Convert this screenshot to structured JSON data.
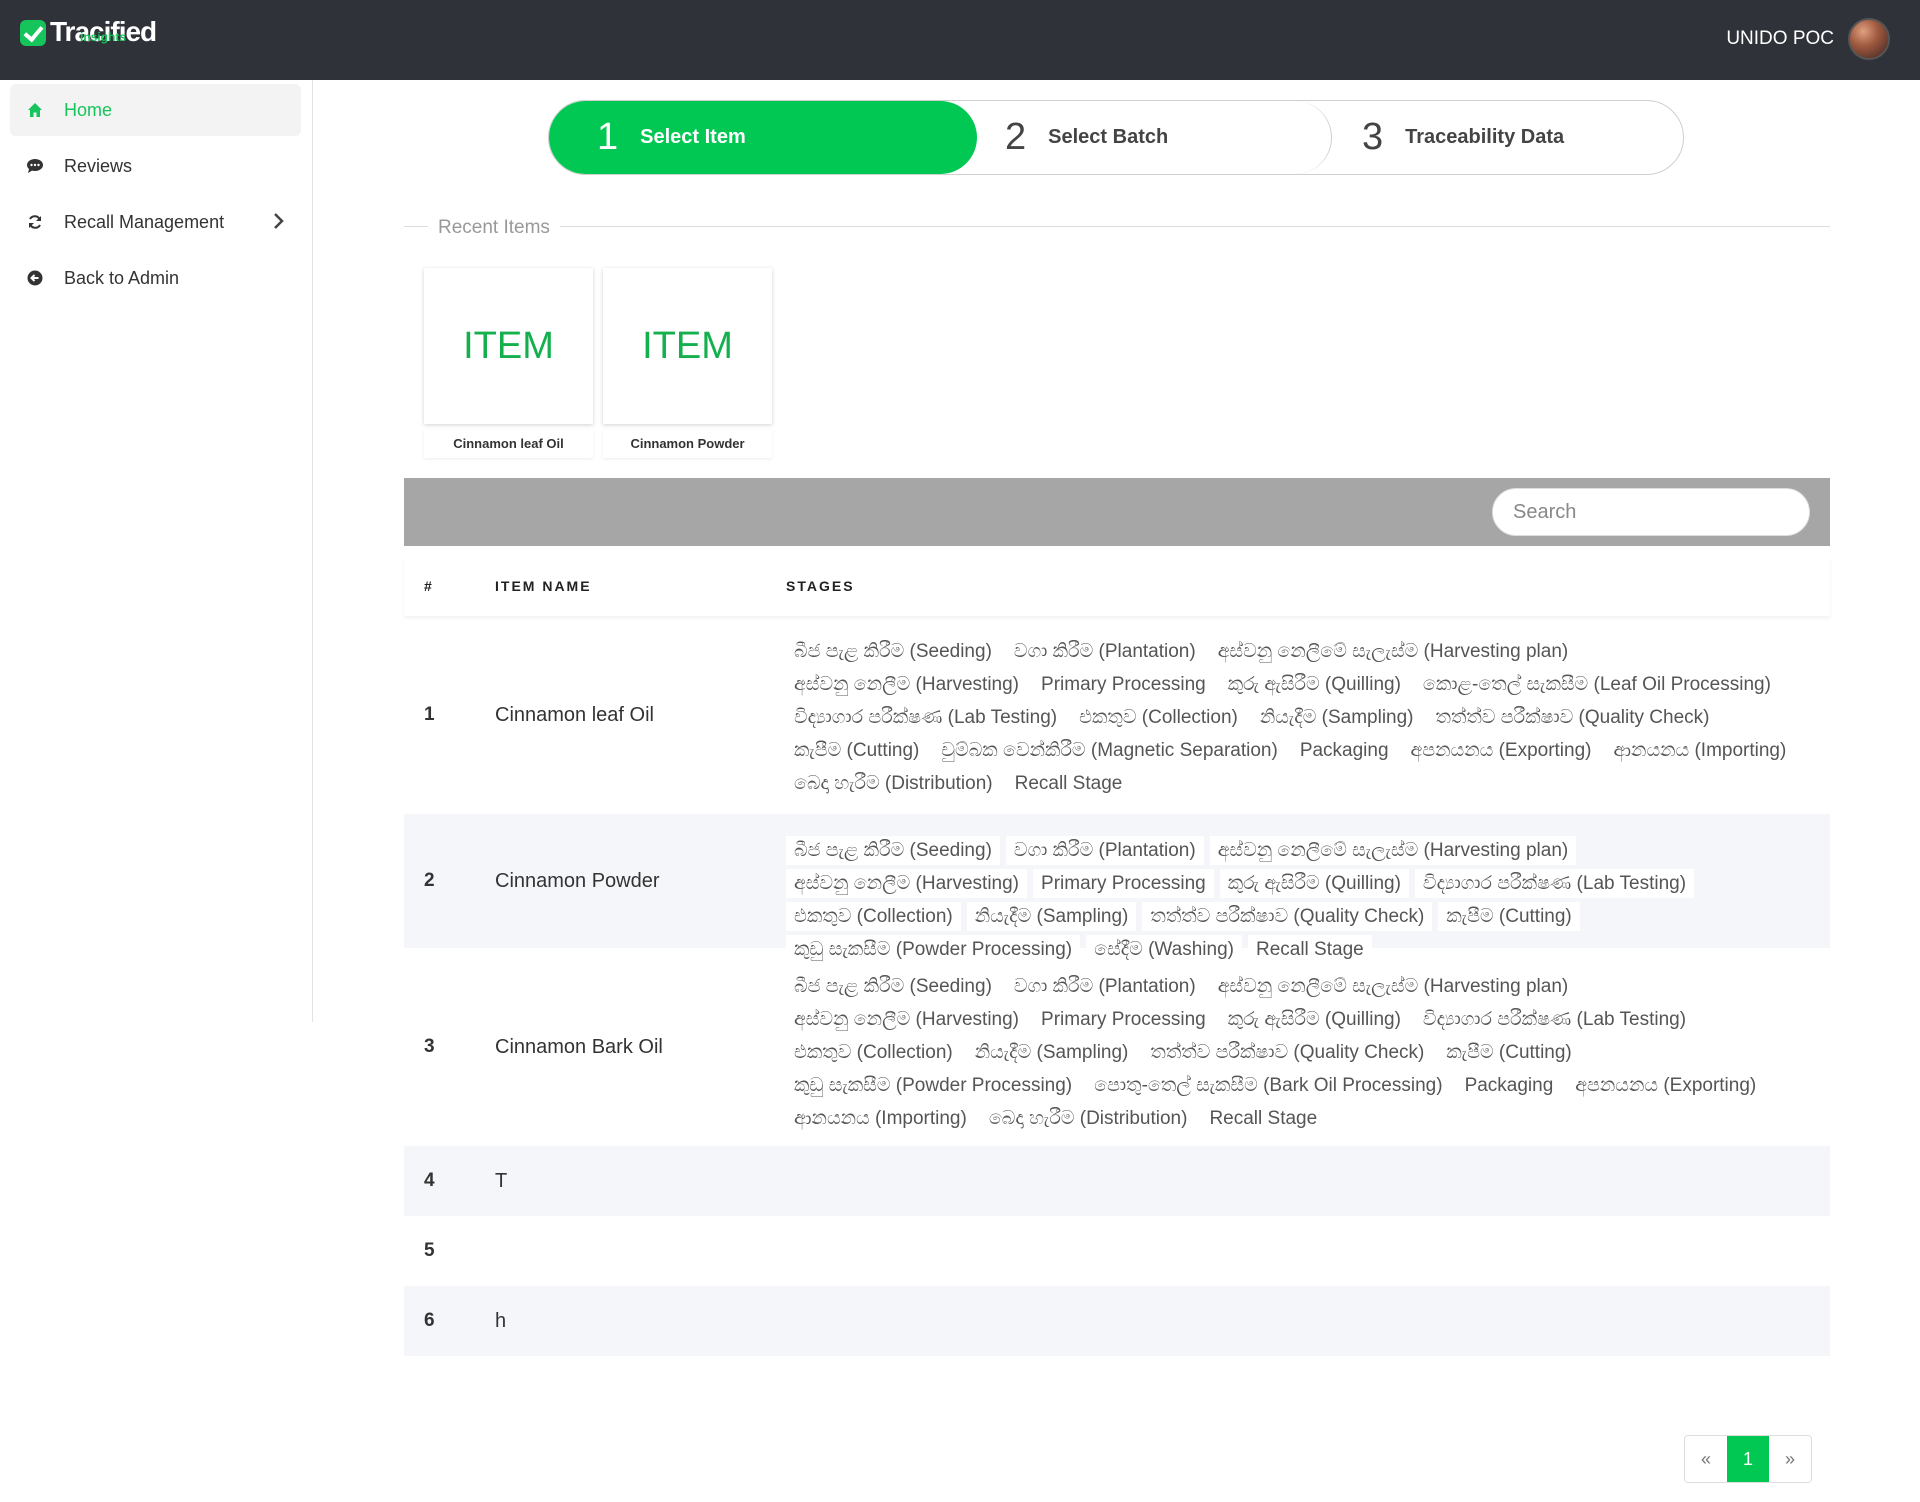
{
  "header": {
    "brand": "Tracified",
    "brand_sub": "insights",
    "user": "UNIDO POC"
  },
  "sidebar": {
    "items": [
      {
        "label": "Home",
        "icon": "home-icon"
      },
      {
        "label": "Reviews",
        "icon": "chat-icon"
      },
      {
        "label": "Recall Management",
        "icon": "refresh-icon"
      },
      {
        "label": "Back to Admin",
        "icon": "back-arrow-icon"
      }
    ]
  },
  "steps": [
    {
      "num": "1",
      "label": "Select Item"
    },
    {
      "num": "2",
      "label": "Select Batch"
    },
    {
      "num": "3",
      "label": "Traceability Data"
    }
  ],
  "recent": {
    "title": "Recent Items",
    "items": [
      {
        "thumb": "ITEM",
        "label": "Cinnamon leaf Oil"
      },
      {
        "thumb": "ITEM",
        "label": "Cinnamon Powder"
      }
    ]
  },
  "search": {
    "placeholder": "Search"
  },
  "table": {
    "headers": [
      "#",
      "ITEM NAME",
      "STAGES"
    ],
    "rows": [
      {
        "num": "1",
        "name": "Cinnamon leaf Oil",
        "stages": [
          "බීජ පැළ කිරීම (Seeding)",
          "වගා කිරීම (Plantation)",
          "අස්වනු නෙලීමේ සැලැස්ම (Harvesting plan)",
          "අස්වනු නෙලීම (Harvesting)",
          "Primary Processing",
          "කුරු ඇසිරීම (Quilling)",
          "කොළ-තෙල් සැකසීම (Leaf Oil Processing)",
          "විද්‍යාගාර පරීක්ෂණ (Lab Testing)",
          "එකතුව (Collection)",
          "නියැදීම (Sampling)",
          "තත්ත්ව පරීක්ෂාව (Quality Check)",
          "කැපීම (Cutting)",
          "චුම්බක වෙන්කිරීම (Magnetic Separation)",
          "Packaging",
          "අපනයනය (Exporting)",
          "ආනයනය (Importing)",
          "බෙදා හැරීම (Distribution)",
          "Recall Stage"
        ]
      },
      {
        "num": "2",
        "name": "Cinnamon Powder",
        "stages": [
          "බීජ පැළ කිරීම (Seeding)",
          "වගා කිරීම (Plantation)",
          "අස්වනු නෙලීමේ සැලැස්ම (Harvesting plan)",
          "අස්වනු නෙලීම (Harvesting)",
          "Primary Processing",
          "කුරු ඇසිරීම (Quilling)",
          "විද්‍යාගාර පරීක්ෂණ (Lab Testing)",
          "එකතුව (Collection)",
          "නියැදීම (Sampling)",
          "තත්ත්ව පරීක්ෂාව (Quality Check)",
          "කැපීම (Cutting)",
          "කුඩු සැකසීම (Powder Processing)",
          "සේදීම (Washing)",
          "Recall Stage"
        ]
      },
      {
        "num": "3",
        "name": "Cinnamon Bark Oil",
        "stages": [
          "බීජ පැළ කිරීම (Seeding)",
          "වගා කිරීම (Plantation)",
          "අස්වනු නෙලීමේ සැලැස්ම (Harvesting plan)",
          "අස්වනු නෙලීම (Harvesting)",
          "Primary Processing",
          "කුරු ඇසිරීම (Quilling)",
          "විද්‍යාගාර පරීක්ෂණ (Lab Testing)",
          "එකතුව (Collection)",
          "නියැදීම (Sampling)",
          "තත්ත්ව පරීක්ෂාව (Quality Check)",
          "කැපීම (Cutting)",
          "කුඩු සැකසීම (Powder Processing)",
          "පොතු-තෙල් සැකසීම (Bark Oil Processing)",
          "Packaging",
          "අපනයනය (Exporting)",
          "ආනයනය (Importing)",
          "බෙදා හැරීම (Distribution)",
          "Recall Stage"
        ]
      },
      {
        "num": "4",
        "name": "T",
        "stages": []
      },
      {
        "num": "5",
        "name": "",
        "stages": []
      },
      {
        "num": "6",
        "name": "h",
        "stages": []
      }
    ]
  },
  "pagination": {
    "prev": "«",
    "current": "1",
    "next": "»"
  },
  "colors": {
    "accent": "#00c853",
    "topbar": "#2f3238",
    "searchbar": "#a6a6a6"
  }
}
